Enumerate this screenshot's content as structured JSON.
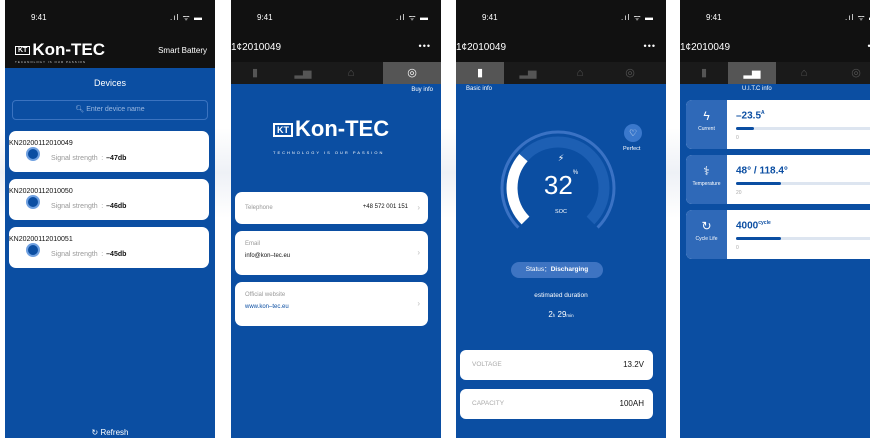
{
  "status_time": "9:41",
  "status_icons": ".ıl ᯤ ▬",
  "icon_names": [
    "battery-icon",
    "chart-icon",
    "bell-icon",
    "globe-icon",
    "heart-icon",
    "bolt-icon",
    "thermometer-icon",
    "refresh-icon",
    "search-icon",
    "cycle-icon"
  ],
  "colors": {
    "primary": "#0b4ea2",
    "dark": "#111111",
    "card": "#ffffff"
  },
  "logo": {
    "box": "KT",
    "text": "Kon-TEC",
    "tagline": "TECHNOLOGY IS OUR PASSION"
  },
  "screen1": {
    "app_title": "Smart Battery",
    "heading": "Devices",
    "search_placeholder": "Enter device name",
    "devices": [
      {
        "id": "KN20200112010049",
        "signal_label": "Signal strength :",
        "signal_value": "–47db"
      },
      {
        "id": "KN20200112010050",
        "signal_label": "Signal strength :",
        "signal_value": "–46db"
      },
      {
        "id": "KN20200112010051",
        "signal_label": "Signal strength :",
        "signal_value": "–45db"
      }
    ],
    "refresh": "Refresh"
  },
  "device_title": "1¢2010049",
  "menu_dots": "•••",
  "tabs": [
    "battery",
    "chart",
    "bell",
    "globe"
  ],
  "screen2": {
    "section": "Buy info",
    "telephone_label": "Telephone",
    "telephone_value": "+48 572 001 151",
    "email_label": "Email",
    "email_value": "info@kon–tec.eu",
    "website_label": "Official website",
    "website_value": "www.kon–tec.eu"
  },
  "screen3": {
    "section": "Basic info",
    "health": "Perfect",
    "soc_value": "32",
    "soc_unit": "%",
    "soc_label": "SOC",
    "soc_fraction": 0.32,
    "status_label": "Status：",
    "status_value": "Discharging",
    "estimated": "estimated duration",
    "duration_h": "2",
    "duration_h_unit": "h",
    "duration_m": "29",
    "duration_m_unit": "min",
    "voltage_label": "VOLTAGE",
    "voltage_value": "13.2V",
    "capacity_label": "CAPACITY",
    "capacity_value": "100AH"
  },
  "screen4": {
    "section": "U.I.T.C info",
    "metrics": [
      {
        "name": "Current",
        "value": "–23.5",
        "unit": "A",
        "min": "0",
        "max": "200",
        "fraction": 0.12
      },
      {
        "name": "Temperature",
        "value": "48° / 118.4°",
        "unit": "",
        "min": "20",
        "max": "80",
        "fraction": 0.3
      },
      {
        "name": "Cycle Life",
        "value": "4000",
        "unit": "cycle",
        "min": "0",
        "max": "100",
        "fraction": 0.3
      }
    ]
  }
}
